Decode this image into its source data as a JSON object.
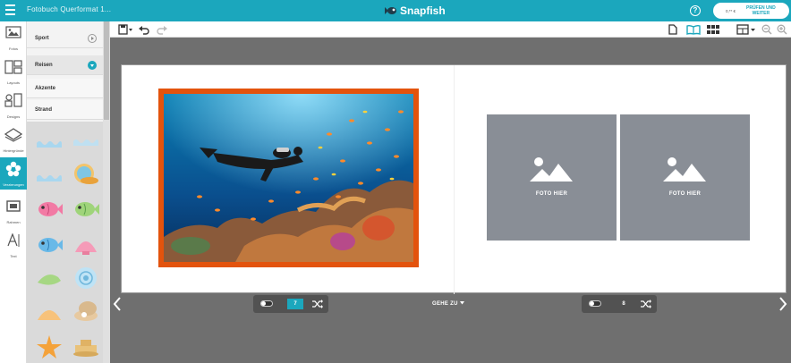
{
  "topbar": {
    "document_title": "Fotobuch Querformat 1...",
    "brand": "Snapfish",
    "help_label": "?",
    "price": "0,** €",
    "checkout_label_line1": "PRÜFEN UND",
    "checkout_label_line2": "WEITER"
  },
  "iconrail": {
    "items": [
      {
        "label": "Fotos",
        "icon": "photos-icon"
      },
      {
        "label": "Layouts",
        "icon": "layouts-icon"
      },
      {
        "label": "Designs",
        "icon": "designs-icon"
      },
      {
        "label": "Hintergründe",
        "icon": "backgrounds-icon"
      },
      {
        "label": "Verzierungen",
        "icon": "embellishments-icon",
        "active": true
      },
      {
        "label": "Rahmen",
        "icon": "frames-icon"
      },
      {
        "label": "Text",
        "icon": "text-icon"
      }
    ]
  },
  "panel": {
    "categories": [
      {
        "label": "Sport",
        "state": "collapsed"
      },
      {
        "label": "Reisen",
        "state": "expanded"
      },
      {
        "label": "Akzente",
        "state": "collapsed-sub"
      },
      {
        "label": "Strand",
        "state": "expanded-sub"
      }
    ],
    "stickers": [
      "wave-border-sticker",
      "wave-border-sticker-2",
      "fish-bowl-sticker",
      "pink-fish-sticker",
      "green-fish-sticker",
      "blue-fish-sticker",
      "pink-shell-sticker",
      "green-shell-sticker",
      "blue-snail-shell-sticker",
      "orange-shell-sticker",
      "oyster-pearl-sticker",
      "starfish-sticker",
      "sandcastle-sticker"
    ]
  },
  "canvas": {
    "left_page_photo": "scuba-diver-coral-reef-photo",
    "placeholder_label": "FOTO HIER",
    "frame_color": "#e3530d"
  },
  "bottombar": {
    "left_page_number": "7",
    "right_page_number": "8",
    "goto_label": "GEHE ZU"
  },
  "colors": {
    "brand": "#1ba7bd",
    "workspace": "#6f6f6f",
    "placeholder": "#898e96"
  }
}
